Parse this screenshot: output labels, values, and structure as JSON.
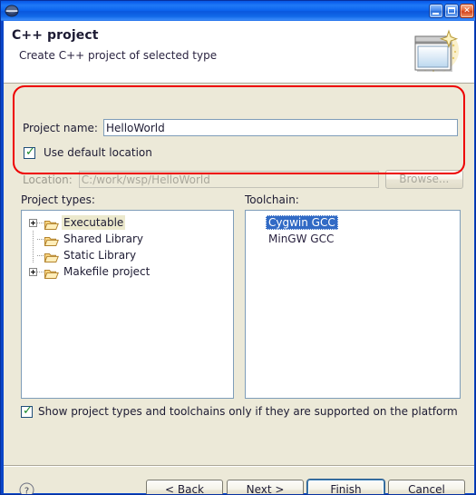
{
  "window": {
    "title": "",
    "logo_icon": "eclipse-logo-icon",
    "controls": [
      {
        "name": "minimize-button",
        "label": "Minimize"
      },
      {
        "name": "maximize-button",
        "label": "Maximize"
      },
      {
        "name": "close-button",
        "label": "Close",
        "glyph": "✕"
      }
    ]
  },
  "banner": {
    "title": "C++ project",
    "subtitle": "Create C++ project of selected type",
    "icon": "new-project-wizard-icon"
  },
  "form": {
    "project_name_label": "Project name:",
    "project_name_value": "HelloWorld",
    "project_name_placeholder": "Project name",
    "use_default_location_label": "Use default location",
    "use_default_location_checked": true,
    "location_label": "Location:",
    "location_value": "C:/work/wsp/HelloWorld",
    "location_placeholder": "Location",
    "location_disabled": true,
    "browse_label": "Browse...",
    "browse_disabled": true
  },
  "project_types": {
    "label": "Project types:",
    "items": [
      {
        "label": "Executable",
        "expandable": true,
        "highlighted": true,
        "icon": "folder-icon"
      },
      {
        "label": "Shared Library",
        "expandable": false,
        "highlighted": false,
        "icon": "folder-icon"
      },
      {
        "label": "Static Library",
        "expandable": false,
        "highlighted": false,
        "icon": "folder-icon"
      },
      {
        "label": "Makefile project",
        "expandable": true,
        "highlighted": false,
        "icon": "folder-icon"
      }
    ]
  },
  "toolchain": {
    "label": "Toolchain:",
    "items": [
      {
        "label": "Cygwin GCC",
        "selected": true
      },
      {
        "label": "MinGW GCC",
        "selected": false
      }
    ]
  },
  "show_supported": {
    "label": "Show project types and toolchains only if they are supported on the platform",
    "checked": true
  },
  "footer": {
    "help_icon": "help-question-icon",
    "buttons": [
      {
        "name": "back-button",
        "pre": "< ",
        "mnemonic": "B",
        "post": "ack",
        "default": false
      },
      {
        "name": "next-button",
        "pre": "",
        "mnemonic": "N",
        "post": "ext >",
        "default": false
      },
      {
        "name": "finish-button",
        "pre": "",
        "mnemonic": "F",
        "post": "inish",
        "default": true
      },
      {
        "name": "cancel-button",
        "pre": "",
        "mnemonic": "",
        "post": "Cancel",
        "default": false
      }
    ]
  },
  "annotation": {
    "highlight_color": "#ee0000",
    "shape": "rounded-rectangle"
  },
  "colors": {
    "titlebar_blue": "#0a58e0",
    "dialog_face": "#ece9d8",
    "selection_blue": "#316ac5",
    "field_border": "#7f9db9",
    "highlight_red": "#ee0000"
  }
}
